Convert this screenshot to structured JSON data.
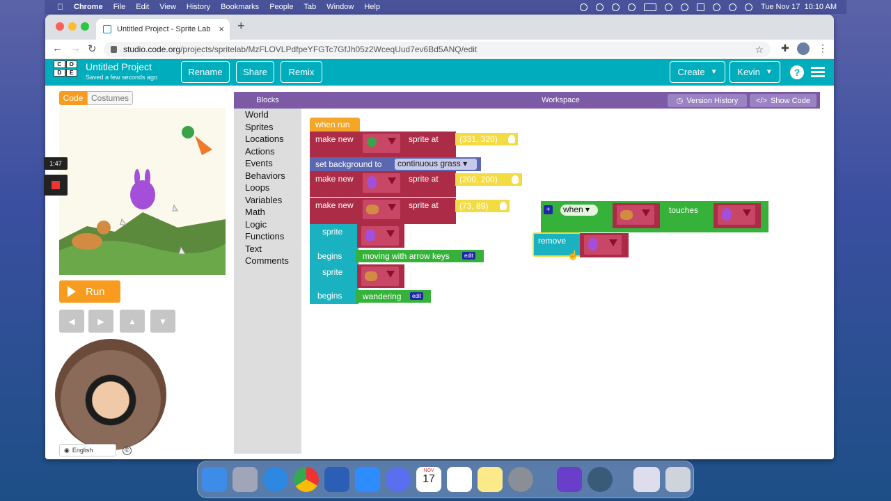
{
  "menubar": {
    "apple": "",
    "items": [
      "Chrome",
      "File",
      "Edit",
      "View",
      "History",
      "Bookmarks",
      "People",
      "Tab",
      "Window",
      "Help"
    ],
    "clock": "Tue Nov 17  10:10 AM"
  },
  "browser": {
    "tab_title": "Untitled Project - Sprite Lab",
    "url_domain": "studio.code.org",
    "url_path": "/projects/spritelab/MzFLOVLPdfpeYFGTc7GfJh05z2WceqUud7ev6Bd5ANQ/edit"
  },
  "header": {
    "logo_letters": [
      "C",
      "O",
      "D",
      "E",
      "",
      ""
    ],
    "project_title": "Untitled Project",
    "saved_status": "Saved a few seconds ago",
    "rename": "Rename",
    "share": "Share",
    "remix": "Remix",
    "create": "Create",
    "user": "Kevin",
    "help": "?"
  },
  "left": {
    "code_tab": "Code",
    "costumes_tab": "Costumes",
    "run": "Run",
    "arrows": [
      "◀",
      "▶",
      "▲",
      "▼"
    ],
    "language": "English",
    "copyright": "©"
  },
  "recording": {
    "timer": "1:47"
  },
  "workspace": {
    "blocks_header": "Blocks",
    "workspace_header": "Workspace",
    "version_history": "Version History",
    "show_code": "Show Code",
    "categories": [
      "World",
      "Sprites",
      "Locations",
      "Actions",
      "Events",
      "Behaviors",
      "Loops",
      "Variables",
      "Math",
      "Logic",
      "Functions",
      "Text",
      "Comments"
    ]
  },
  "code": {
    "when_run": "when run",
    "make_new": "make new",
    "sprite_at": "sprite at",
    "pos1": "(331, 320)",
    "set_bg": "set background to",
    "bg_value": "continuous grass",
    "pos2": "(200, 200)",
    "pos3": "(73, 89)",
    "sprite": "sprite",
    "begins": "begins",
    "behavior1": "moving with arrow keys",
    "behavior2": "wandering",
    "edit": "edit",
    "when": "when",
    "touches": "touches",
    "remove": "remove",
    "plus": "+"
  },
  "colors": {
    "teal_header": "#00adbc",
    "orange": "#f79c1f",
    "purple": "#7c5aa6",
    "red_block": "#ac2b46",
    "green_block": "#36b23a",
    "teal_block": "#1ab2c0"
  },
  "dock": {
    "calendar_month": "NOV",
    "calendar_day": "17"
  }
}
